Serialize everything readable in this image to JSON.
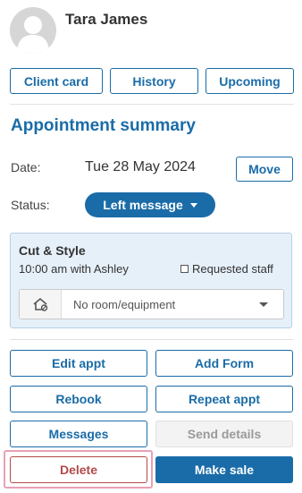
{
  "client": {
    "name": "Tara James"
  },
  "tabs": {
    "client_card": "Client card",
    "history": "History",
    "upcoming": "Upcoming"
  },
  "summary": {
    "title": "Appointment summary",
    "date_label": "Date:",
    "date_value": "Tue 28 May 2024",
    "move_label": "Move",
    "status_label": "Status:",
    "status_value": "Left message"
  },
  "service": {
    "name": "Cut & Style",
    "time_staff": "10:00 am with Ashley",
    "requested_staff_label": "Requested staff",
    "room_placeholder": "No room/equipment"
  },
  "actions": {
    "edit_appt": "Edit appt",
    "add_form": "Add Form",
    "rebook": "Rebook",
    "repeat_appt": "Repeat appt",
    "messages": "Messages",
    "send_details": "Send details",
    "delete": "Delete",
    "make_sale": "Make sale"
  },
  "colors": {
    "accent": "#1a6ca8",
    "danger": "#b44a4a",
    "panel": "#e6f0f9"
  },
  "icons": {
    "avatar": "user-avatar-icon",
    "room": "room-equipment-icon",
    "status_caret": "chevron-down-icon",
    "room_caret": "chevron-down-icon"
  }
}
